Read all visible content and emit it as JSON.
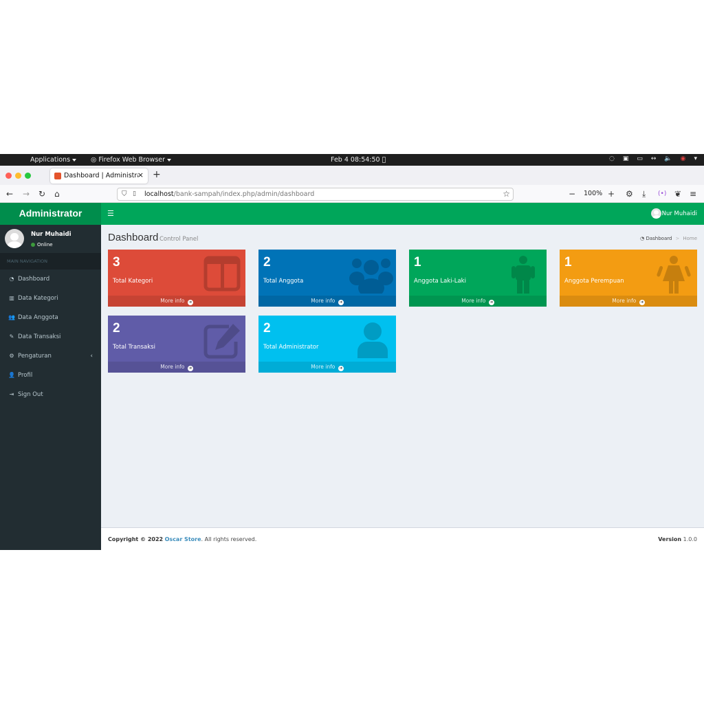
{
  "os": {
    "applications": "Applications",
    "browser_menu": "Firefox Web Browser",
    "clock": "Feb 4  08:54:50"
  },
  "browser": {
    "tab_title": "Dashboard | Administrator",
    "url_host": "localhost",
    "url_path": "/bank-sampah/index.php/admin/dashboard",
    "zoom": "100%"
  },
  "app": {
    "logo": "Administrator",
    "top_user": "Nur Muhaidi",
    "user": {
      "name": "Nur Muhaidi",
      "status": "Online"
    },
    "nav_header": "MAIN NAVIGATION",
    "menu": [
      {
        "label": "Dashboard",
        "icon": "dashboard-icon"
      },
      {
        "label": "Data Kategori",
        "icon": "columns-icon"
      },
      {
        "label": "Data Anggota",
        "icon": "users-icon"
      },
      {
        "label": "Data Transaksi",
        "icon": "edit-icon"
      },
      {
        "label": "Pengaturan",
        "icon": "cogs-icon"
      },
      {
        "label": "Profil",
        "icon": "user-icon"
      },
      {
        "label": "Sign Out",
        "icon": "sign-out-icon"
      }
    ],
    "page_title": "Dashboard",
    "page_subtitle": "Control Panel",
    "breadcrumb": {
      "home_link": "Dashboard",
      "current": "Home"
    },
    "more_info": "More info",
    "boxes": [
      {
        "value": "3",
        "label": "Total Kategori",
        "color": "#dd4b39",
        "icon": "columns-icon"
      },
      {
        "value": "2",
        "label": "Total Anggota",
        "color": "#0073b7",
        "icon": "users-icon"
      },
      {
        "value": "1",
        "label": "Anggota Laki-Laki",
        "color": "#00a65a",
        "icon": "male-icon"
      },
      {
        "value": "1",
        "label": "Anggota Perempuan",
        "color": "#f39c12",
        "icon": "female-icon"
      },
      {
        "value": "2",
        "label": "Total Transaksi",
        "color": "#605ca8",
        "icon": "edit-icon"
      },
      {
        "value": "2",
        "label": "Total Administrator",
        "color": "#00c0ef",
        "icon": "user-icon"
      }
    ],
    "footer": {
      "copyright": "Copyright © 2022",
      "company": "Oscar Store",
      "rights": ". All rights reserved.",
      "version_label": "Version",
      "version": "1.0.0"
    }
  }
}
